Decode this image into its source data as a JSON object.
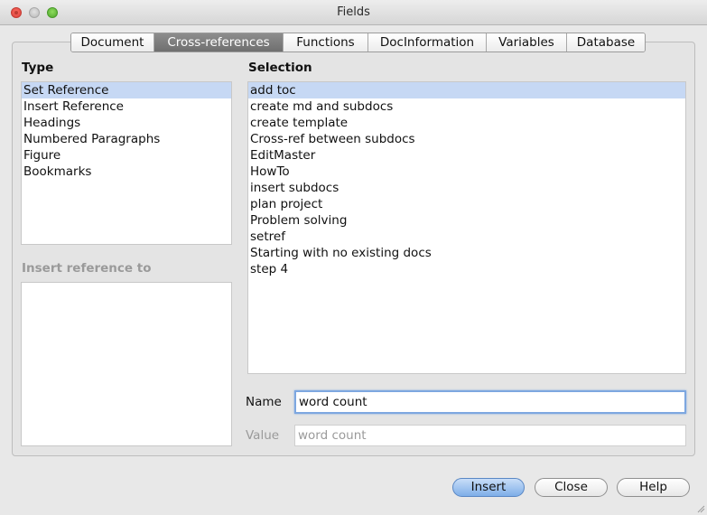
{
  "window": {
    "title": "Fields"
  },
  "tabs": [
    {
      "label": "Document"
    },
    {
      "label": "Cross-references"
    },
    {
      "label": "Functions"
    },
    {
      "label": "DocInformation"
    },
    {
      "label": "Variables"
    },
    {
      "label": "Database"
    }
  ],
  "active_tab": "Cross-references",
  "type_section": {
    "label": "Type",
    "items": [
      "Set Reference",
      "Insert Reference",
      "Headings",
      "Numbered Paragraphs",
      "Figure",
      "Bookmarks"
    ],
    "selected": "Set Reference"
  },
  "insert_ref_section": {
    "label": "Insert reference to"
  },
  "selection_section": {
    "label": "Selection",
    "items": [
      "add toc",
      "create md and subdocs",
      "create template",
      "Cross-ref between subdocs",
      "EditMaster",
      "HowTo",
      "insert subdocs",
      "plan project",
      "Problem solving",
      "setref",
      "Starting with no existing docs",
      "step 4"
    ],
    "selected": "add toc"
  },
  "name_field": {
    "label": "Name",
    "value": "word count"
  },
  "value_field": {
    "label": "Value",
    "value": "word count"
  },
  "buttons": {
    "insert": "Insert",
    "close": "Close",
    "help": "Help"
  },
  "colors": {
    "selection": "#c6d8f4",
    "active_tab": "#7a7a7a",
    "default_button": "#7eaee8"
  }
}
